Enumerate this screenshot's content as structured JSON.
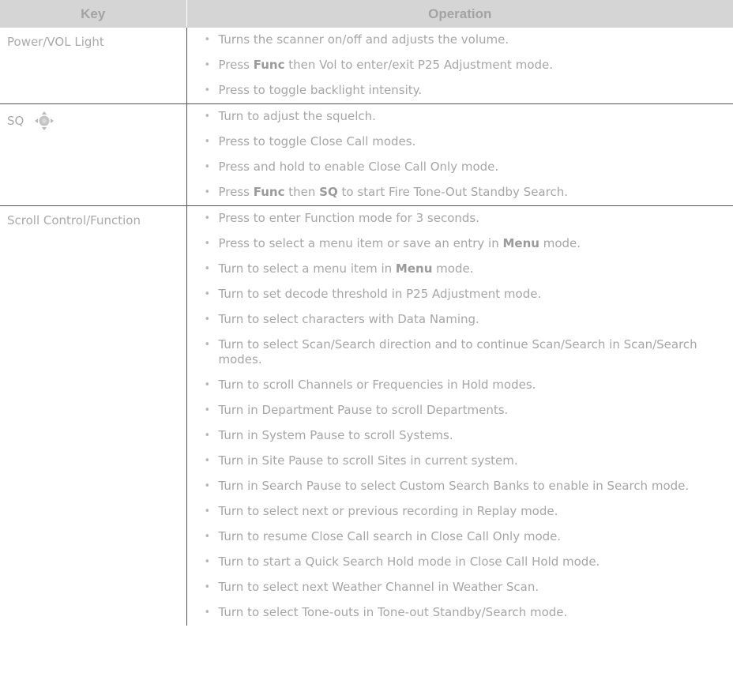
{
  "headers": {
    "key": "Key",
    "operation": "Operation"
  },
  "rows": [
    {
      "key": "Power/VOL Light",
      "icon": null,
      "ops": [
        [
          {
            "t": "Turns the scanner on/off and adjusts the volume."
          }
        ],
        [
          {
            "t": "Press "
          },
          {
            "t": "Func",
            "b": true
          },
          {
            "t": " then Vol to enter/exit P25 Adjustment mode."
          }
        ],
        [
          {
            "t": "Press to toggle backlight intensity."
          }
        ]
      ]
    },
    {
      "key": "SQ",
      "icon": "squelch-knob-icon",
      "ops": [
        [
          {
            "t": "Turn to adjust the squelch."
          }
        ],
        [
          {
            "t": "Press to toggle Close Call modes."
          }
        ],
        [
          {
            "t": "Press and hold to enable Close Call Only mode."
          }
        ],
        [
          {
            "t": "Press "
          },
          {
            "t": "Func",
            "b": true
          },
          {
            "t": " then "
          },
          {
            "t": "SQ",
            "b": true
          },
          {
            "t": " to start Fire Tone-Out Standby Search."
          }
        ]
      ]
    },
    {
      "key": "Scroll Control/Function",
      "icon": null,
      "ops": [
        [
          {
            "t": "Press to enter Function mode for 3 seconds."
          }
        ],
        [
          {
            "t": "Press to select a menu item or save an entry in "
          },
          {
            "t": "Menu",
            "b": true
          },
          {
            "t": " mode."
          }
        ],
        [
          {
            "t": "Turn to select a menu item in "
          },
          {
            "t": "Menu",
            "b": true
          },
          {
            "t": " mode."
          }
        ],
        [
          {
            "t": "Turn to set decode threshold in P25 Adjustment mode."
          }
        ],
        [
          {
            "t": "Turn to select characters with Data Naming."
          }
        ],
        [
          {
            "t": "Turn to select Scan/Search direction and to continue Scan/Search in Scan/Search modes."
          }
        ],
        [
          {
            "t": "Turn to scroll Channels or Frequencies in Hold modes."
          }
        ],
        [
          {
            "t": "Turn in Department Pause to scroll Departments."
          }
        ],
        [
          {
            "t": "Turn in System Pause to scroll Systems."
          }
        ],
        [
          {
            "t": "Turn in Site Pause to scroll Sites in current system."
          }
        ],
        [
          {
            "t": "Turn in Search Pause to select Custom Search Banks to enable in Search mode."
          }
        ],
        [
          {
            "t": "Turn to select next or previous recording in Replay mode."
          }
        ],
        [
          {
            "t": "Turn to resume Close Call search in Close Call Only mode."
          }
        ],
        [
          {
            "t": "Turn to start a Quick Search Hold mode in Close Call Hold mode."
          }
        ],
        [
          {
            "t": "Turn to select next Weather Channel in Weather Scan."
          }
        ],
        [
          {
            "t": "Turn to select Tone-outs in Tone-out Standby/Search mode."
          }
        ]
      ]
    }
  ],
  "colors": {
    "header_bg": "#d5d5d5",
    "header_text": "#a3a3a3",
    "body_text": "#a6a6a6",
    "rule": "#555555"
  }
}
